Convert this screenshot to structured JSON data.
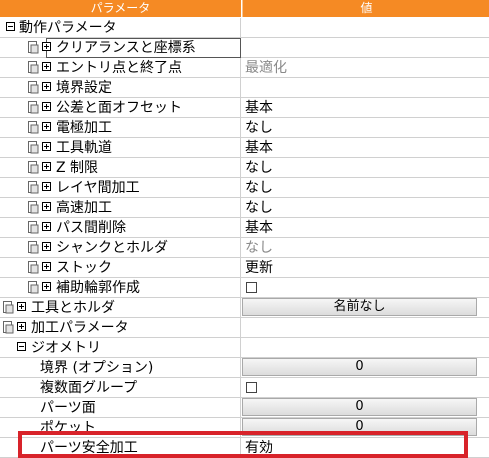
{
  "header": {
    "col_param": "パラメータ",
    "col_value": "値"
  },
  "rows": [
    {
      "label": "動作パラメータ"
    },
    {
      "label": "クリアランスと座標系",
      "value": ""
    },
    {
      "label": "エントリ点と終了点",
      "value": "最適化"
    },
    {
      "label": "境界設定",
      "value": ""
    },
    {
      "label": "公差と面オフセット",
      "value": "基本"
    },
    {
      "label": "電極加工",
      "value": "なし"
    },
    {
      "label": "工具軌道",
      "value": "基本"
    },
    {
      "label": "Z 制限",
      "value": "なし"
    },
    {
      "label": "レイヤ間加工",
      "value": "なし"
    },
    {
      "label": "高速加工",
      "value": "なし"
    },
    {
      "label": "パス間削除",
      "value": "基本"
    },
    {
      "label": "シャンクとホルダ",
      "value": "なし"
    },
    {
      "label": "ストック",
      "value": "更新"
    },
    {
      "label": "補助輪郭作成",
      "value": ""
    },
    {
      "label": "工具とホルダ",
      "button": "名前なし"
    },
    {
      "label": "加工パラメータ",
      "value": ""
    },
    {
      "label": "ジオメトリ",
      "value": ""
    },
    {
      "label": "境界 (オプション)",
      "button": "0"
    },
    {
      "label": "複数面グループ",
      "value": ""
    },
    {
      "label": "パーツ面",
      "button": "0"
    },
    {
      "label": "ポケット",
      "button": "0"
    },
    {
      "label": "パーツ安全加工",
      "value": "有効"
    }
  ],
  "colors": {
    "header": "#f58a24",
    "highlight": "#d8232a"
  }
}
